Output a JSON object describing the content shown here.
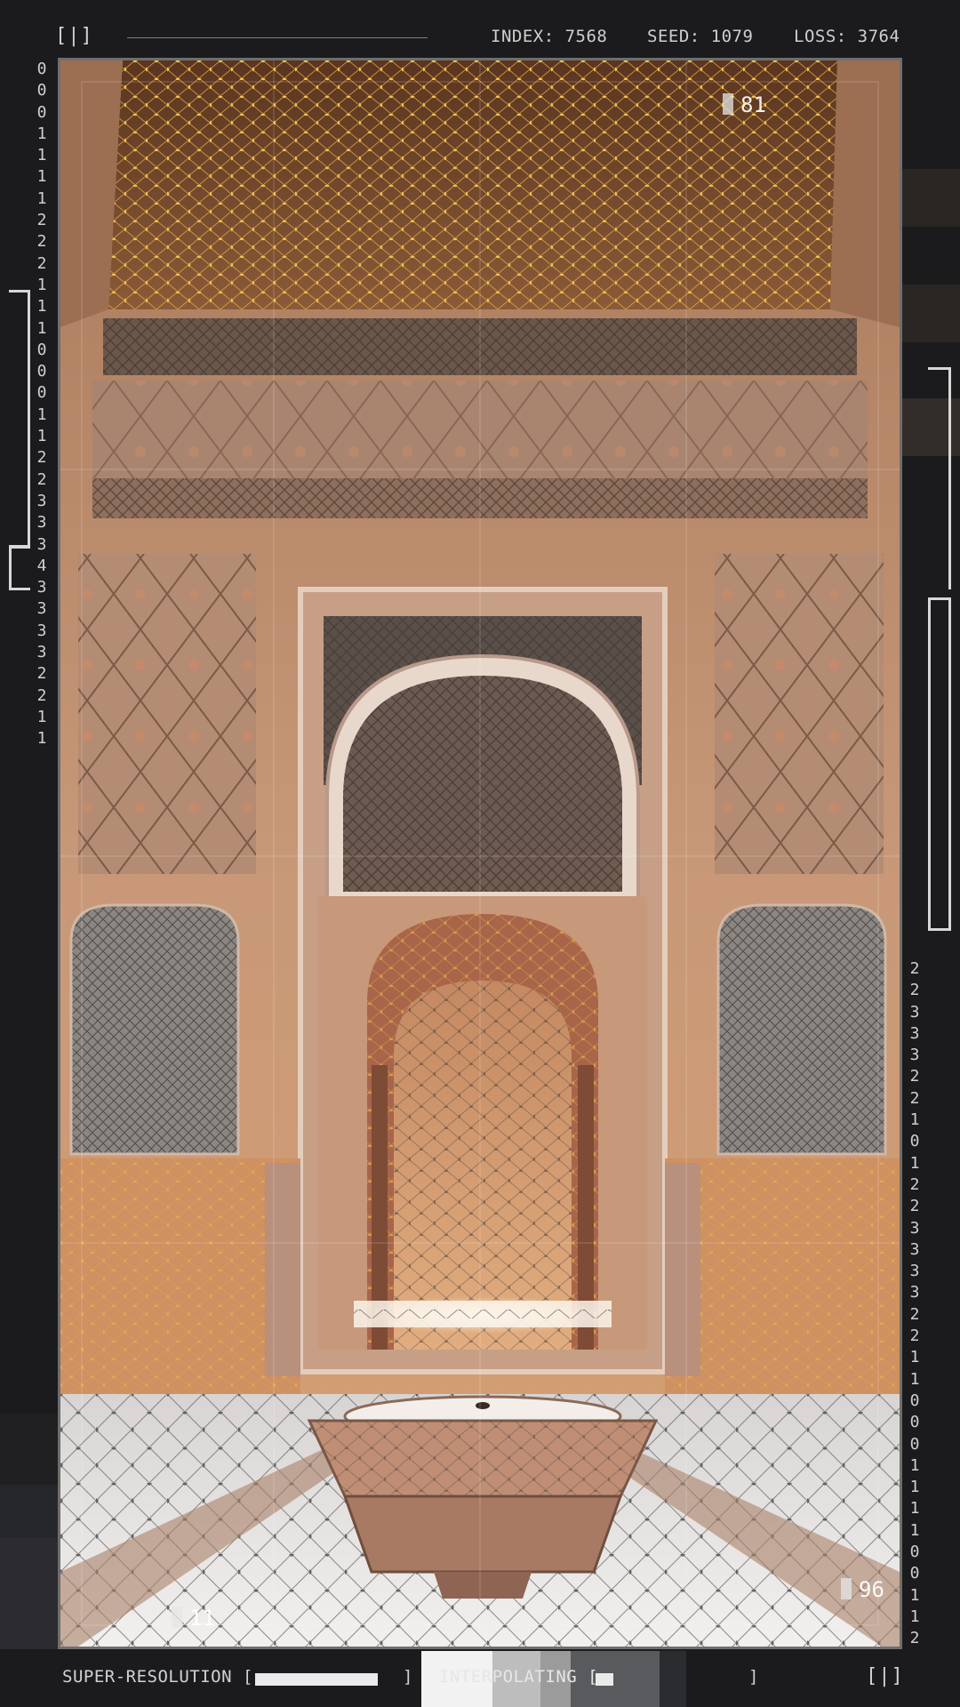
{
  "header": {
    "left_icon": "[|]",
    "index_label": "INDEX: 7568",
    "seed_label": "SEED: 1079",
    "loss_label": "LOSS: 3764"
  },
  "left_digits": [
    "0",
    "0",
    "0",
    "1",
    "1",
    "1",
    "1",
    "2",
    "2",
    "2",
    "1",
    "1",
    "1",
    "0",
    "0",
    "0",
    "1",
    "1",
    "2",
    "2",
    "3",
    "3",
    "3",
    "4",
    "3",
    "3",
    "3",
    "3",
    "2",
    "2",
    "1",
    "1"
  ],
  "right_digits": [
    "2",
    "2",
    "3",
    "3",
    "3",
    "2",
    "2",
    "1",
    "0",
    "1",
    "2",
    "2",
    "3",
    "3",
    "3",
    "3",
    "2",
    "2",
    "1",
    "1",
    "0",
    "0",
    "0",
    "1",
    "1",
    "1",
    "1",
    "0",
    "0",
    "1",
    "1",
    "2"
  ],
  "image_tags": {
    "top_right": "81",
    "bottom_left": "11",
    "bottom_right": "96"
  },
  "footer": {
    "left_label": "SUPER-RESOLUTION [",
    "left_close": "]",
    "left_progress": 0.86,
    "middle_label": "INTERPOLATING [",
    "middle_progress": 0.12,
    "middle_close": "]",
    "right_icon": "[|]"
  },
  "colors": {
    "background": "#1b1b1d",
    "text": "#cfcfcf",
    "accent_node": "#e8b545",
    "mesh": "#3a3a3a"
  }
}
